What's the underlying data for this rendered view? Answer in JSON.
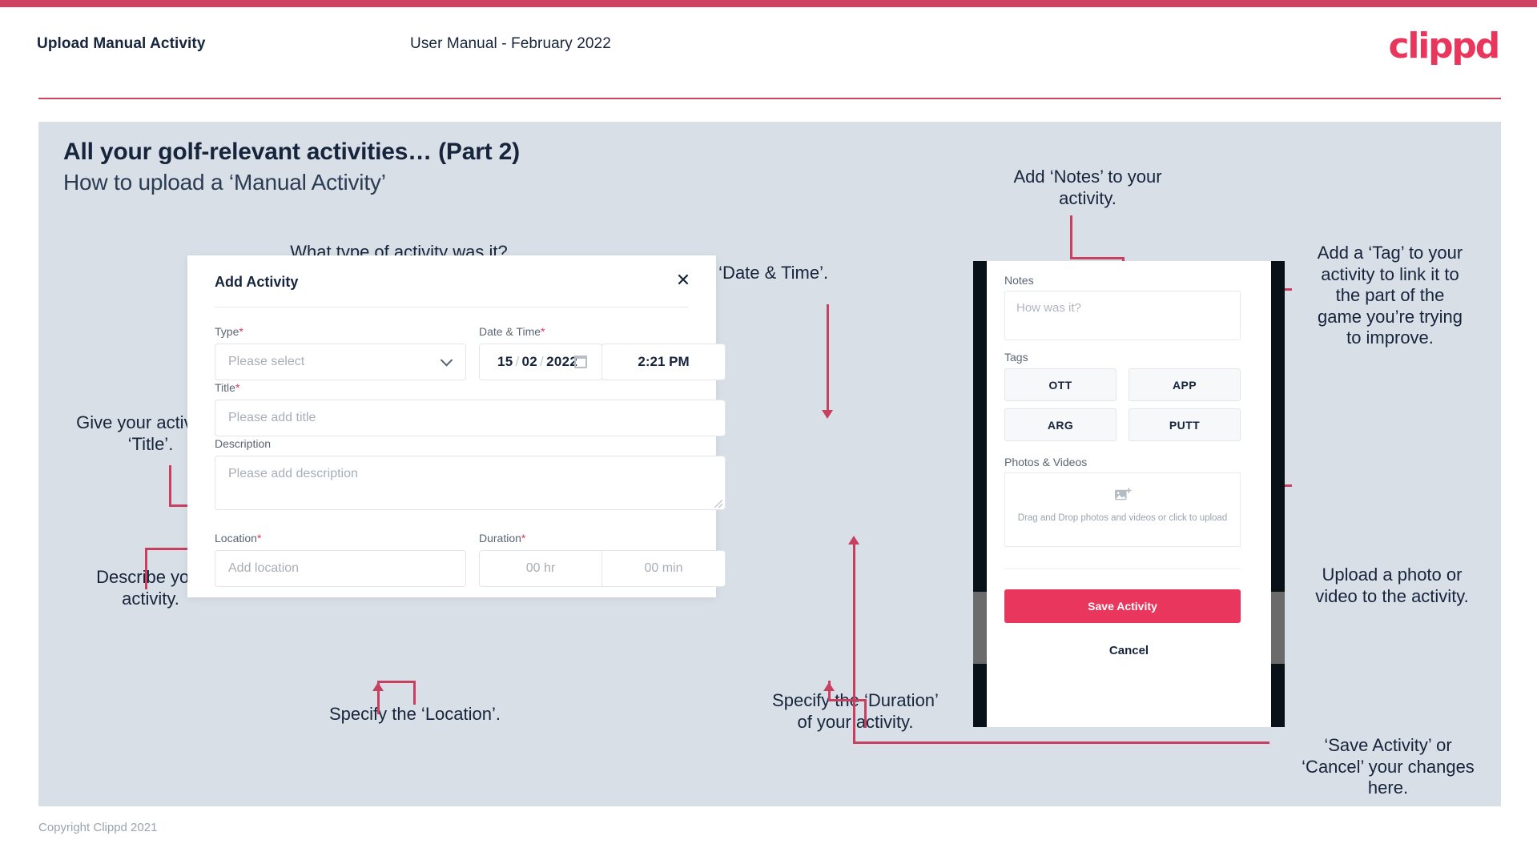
{
  "theme": {
    "accent": "#e8365c",
    "bar": "#cf4360",
    "arrow": "#c8405f",
    "slide_bg": "#d8dfe7",
    "ink": "#16243c"
  },
  "header": {
    "title": "Upload Manual Activity",
    "subtitle": "User Manual - February 2022",
    "logo": "clippd"
  },
  "slide": {
    "heading": "All your golf-relevant activities… (Part 2)",
    "subheading": "How to upload a ‘Manual Activity’"
  },
  "footer": {
    "copyright": "Copyright Clippd 2021"
  },
  "annotations": {
    "type": "What type of activity was it?\nLesson, Chipping etc.",
    "datetime": "Add ‘Date & Time’.",
    "title": "Give your activity a\n‘Title’.",
    "description": "Describe your\nactivity.",
    "location": "Specify the ‘Location’.",
    "duration": "Specify the ‘Duration’\nof your activity.",
    "notes": "Add ‘Notes’ to your\nactivity.",
    "tags": "Add a ‘Tag’ to your\nactivity to link it to\nthe part of the\ngame you’re trying\nto improve.",
    "photos": "Upload a photo or\nvideo to the activity.",
    "save": "‘Save Activity’ or\n‘Cancel’ your changes\nhere."
  },
  "dialog": {
    "title": "Add Activity",
    "close_icon": "close-icon",
    "fields": {
      "type": {
        "label": "Type",
        "required": "*",
        "placeholder": "Please select",
        "icon": "chevron-down-icon"
      },
      "datetime": {
        "label": "Date & Time",
        "required": "*",
        "day": "15",
        "month": "02",
        "year": "2022",
        "time": "2:21 PM",
        "icon": "calendar-icon"
      },
      "title": {
        "label": "Title",
        "required": "*",
        "placeholder": "Please add title"
      },
      "description": {
        "label": "Description",
        "required": "",
        "placeholder": "Please add description"
      },
      "location": {
        "label": "Location",
        "required": "*",
        "placeholder": "Add location"
      },
      "duration": {
        "label": "Duration",
        "required": "*",
        "hours_placeholder": "00 hr",
        "minutes_placeholder": "00 min"
      }
    }
  },
  "phone": {
    "notes": {
      "label": "Notes",
      "placeholder": "How was it?"
    },
    "tags": {
      "label": "Tags",
      "buttons": [
        "OTT",
        "APP",
        "ARG",
        "PUTT"
      ]
    },
    "photos": {
      "label": "Photos & Videos",
      "icon": "add-image-icon",
      "dropzone_text": "Drag and Drop photos and videos or click to upload"
    },
    "save_label": "Save Activity",
    "cancel_label": "Cancel"
  }
}
